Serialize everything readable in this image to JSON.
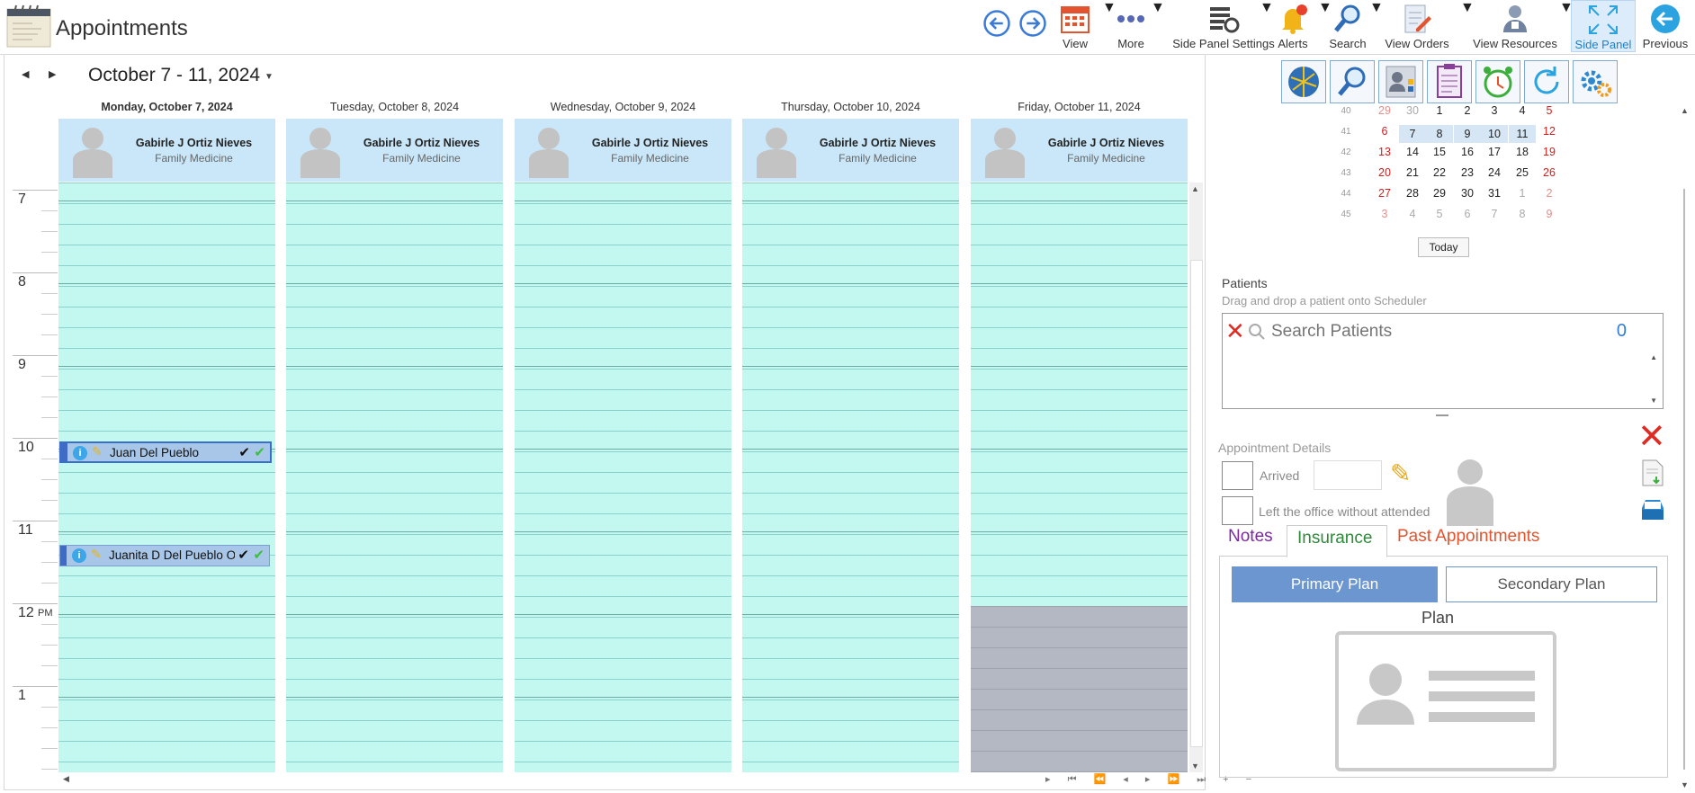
{
  "app": {
    "title": "Appointments"
  },
  "toolbar": [
    {
      "key": "view",
      "label": "View",
      "icon": "calendar-icon"
    },
    {
      "key": "more",
      "label": "More",
      "icon": "more-dots-icon"
    },
    {
      "key": "side_panel_settings",
      "label": "Side Panel Settings",
      "icon": "panel-settings-icon"
    },
    {
      "key": "alerts",
      "label": "Alerts",
      "icon": "bell-icon"
    },
    {
      "key": "search",
      "label": "Search",
      "icon": "search-icon"
    },
    {
      "key": "view_orders",
      "label": "View Orders",
      "icon": "orders-icon"
    },
    {
      "key": "view_resources",
      "label": "View Resources",
      "icon": "resources-icon"
    },
    {
      "key": "side_panel",
      "label": "Side Panel",
      "icon": "expand-icon"
    },
    {
      "key": "previous",
      "label": "Previous",
      "icon": "back-arrow-icon"
    }
  ],
  "scheduler": {
    "date_range": "October 7 - 11, 2024",
    "days": [
      {
        "header": "Monday, October 7, 2024",
        "resource_name": "Gabirle J Ortiz Nieves",
        "resource_specialty": "Family Medicine"
      },
      {
        "header": "Tuesday, October 8, 2024",
        "resource_name": "Gabirle J Ortiz Nieves",
        "resource_specialty": "Family Medicine"
      },
      {
        "header": "Wednesday, October 9, 2024",
        "resource_name": "Gabirle J Ortiz Nieves",
        "resource_specialty": "Family Medicine"
      },
      {
        "header": "Thursday, October 10, 2024",
        "resource_name": "Gabirle J Ortiz Nieves",
        "resource_specialty": "Family Medicine"
      },
      {
        "header": "Friday, October 11, 2024",
        "resource_name": "Gabirle J Ortiz Nieves",
        "resource_specialty": "Family Medicine"
      }
    ],
    "hours": [
      "7",
      "8",
      "9",
      "10",
      "11",
      "12",
      "1"
    ],
    "pm_label": "PM",
    "appointments": [
      {
        "patient": "Juan Del Pueblo",
        "selected": true
      },
      {
        "patient": "Juanita D Del Pueblo Ortiz",
        "selected": false
      }
    ]
  },
  "mini_calendar": {
    "weeks": [
      {
        "week": "40",
        "days": [
          "29",
          "30",
          "1",
          "2",
          "3",
          "4",
          "5"
        ]
      },
      {
        "week": "41",
        "days": [
          "6",
          "7",
          "8",
          "9",
          "10",
          "11",
          "12"
        ]
      },
      {
        "week": "42",
        "days": [
          "13",
          "14",
          "15",
          "16",
          "17",
          "18",
          "19"
        ]
      },
      {
        "week": "43",
        "days": [
          "20",
          "21",
          "22",
          "23",
          "24",
          "25",
          "26"
        ]
      },
      {
        "week": "44",
        "days": [
          "27",
          "28",
          "29",
          "30",
          "31",
          "1",
          "2"
        ]
      },
      {
        "week": "45",
        "days": [
          "3",
          "4",
          "5",
          "6",
          "7",
          "8",
          "9"
        ]
      }
    ],
    "today_label": "Today",
    "weekend_color": "#d0201f"
  },
  "patients": {
    "title": "Patients",
    "hint": "Drag and drop a patient onto Scheduler",
    "search_placeholder": "Search Patients",
    "count": "0"
  },
  "appointment_details": {
    "title": "Appointment Details",
    "arrived_label": "Arrived",
    "left_label": "Left the office without attended",
    "tabs": {
      "notes": "Notes",
      "insurance": "Insurance",
      "past": "Past Appointments"
    },
    "primary_plan": "Primary Plan",
    "secondary_plan": "Secondary Plan",
    "plan_label": "Plan"
  },
  "colors": {
    "slot": "#c3f8f1",
    "resource_header": "#c9e7f8",
    "appointment": "#a8c6e8",
    "accent": "#3f6bc6"
  }
}
